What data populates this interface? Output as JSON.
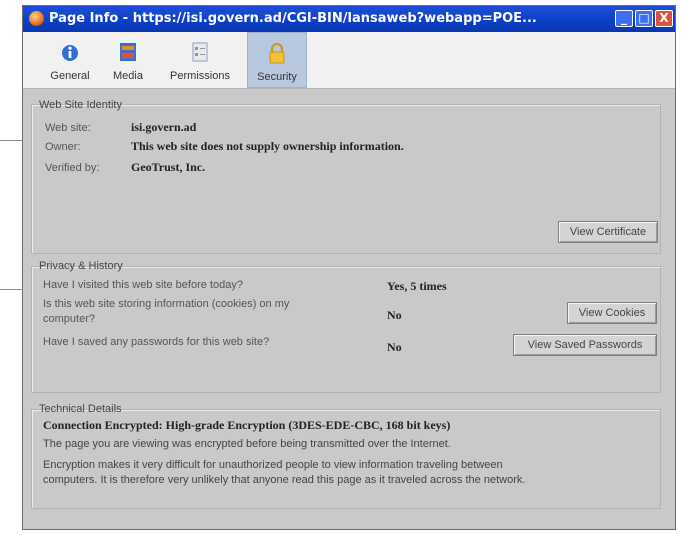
{
  "window": {
    "title": "Page Info - https://isi.govern.ad/CGI-BIN/lansaweb?webapp=POE...",
    "minimize_symbol": "_",
    "maximize_symbol": "□",
    "close_symbol": "X"
  },
  "tabs": [
    {
      "label": "General",
      "icon": "info-icon",
      "selected": false
    },
    {
      "label": "Media",
      "icon": "media-icon",
      "selected": false
    },
    {
      "label": "Permissions",
      "icon": "permissions-icon",
      "selected": false
    },
    {
      "label": "Security",
      "icon": "lock-icon",
      "selected": true
    }
  ],
  "identity": {
    "title": "Web Site Identity",
    "website_label": "Web site:",
    "website_value": "isi.govern.ad",
    "owner_label": "Owner:",
    "owner_value": "This web site does not supply ownership information.",
    "verified_label": "Verified by:",
    "verified_value": "GeoTrust, Inc.",
    "view_certificate_button": "View Certificate"
  },
  "privacy": {
    "title": "Privacy & History",
    "q1": "Have I visited this web site before today?",
    "a1": "Yes, 5 times",
    "q2_line1": "Is this web site storing information (cookies) on my",
    "q2_line2": "computer?",
    "a2": "No",
    "view_cookies_button": "View Cookies",
    "q3": "Have I saved any passwords for this web site?",
    "a3": "No",
    "view_passwords_button": "View Saved Passwords"
  },
  "technical": {
    "title": "Technical Details",
    "headline": "Connection Encrypted: High-grade Encryption (3DES-EDE-CBC, 168 bit keys)",
    "line1": "The page you are viewing was encrypted before being transmitted over the Internet.",
    "line2": "Encryption makes it very difficult for unauthorized people to view information traveling between",
    "line3": "computers. It is therefore very unlikely that anyone read this page as it traveled across the network."
  },
  "colors": {
    "titlebar": "#0b3fc8",
    "dialog_bg": "#c9c9c9",
    "selected_tab": "#b8c9df"
  }
}
